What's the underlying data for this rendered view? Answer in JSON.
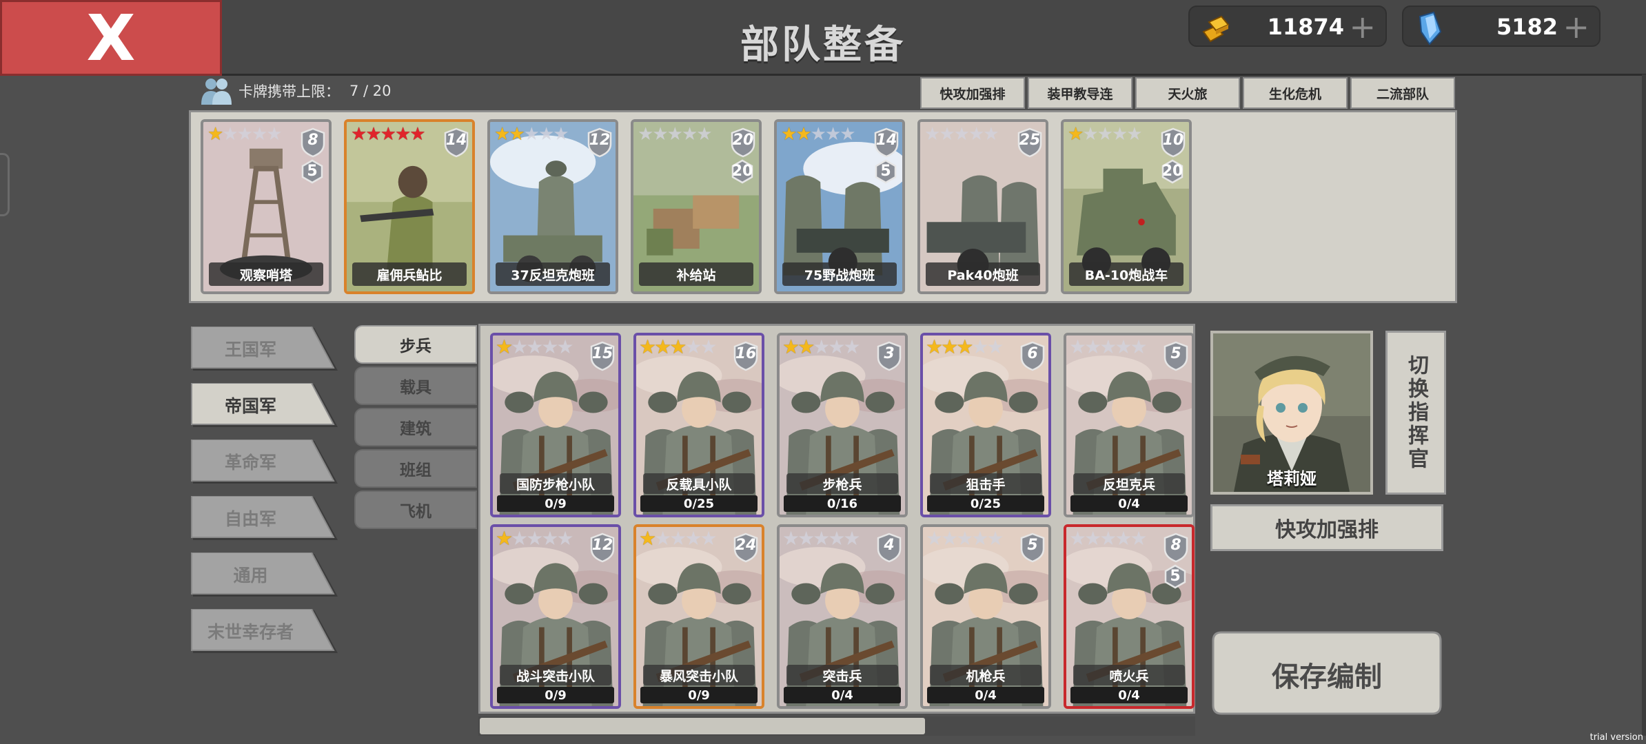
{
  "header": {
    "close_label": "X",
    "title": "部队整备",
    "gold": {
      "value": "11874",
      "icon": "gold-bars-icon",
      "plus": "+"
    },
    "crystal": {
      "value": "5182",
      "icon": "blue-crystal-icon",
      "plus": "+"
    }
  },
  "deck": {
    "carry_limit_label": "卡牌携带上限：",
    "carry_limit_value": "7 / 20",
    "preset_tabs": [
      "快攻加强排",
      "装甲教导连",
      "天火旅",
      "生化危机",
      "二流部队"
    ],
    "cards": [
      {
        "name": "观察哨塔",
        "stars": 1,
        "star_color": "gold",
        "cost": "8",
        "sub": "5",
        "frame": "gray"
      },
      {
        "name": "雇佣兵鲇比",
        "stars": 5,
        "star_color": "red",
        "cost": "14",
        "sub": null,
        "frame": "orange"
      },
      {
        "name": "37反坦克炮班",
        "stars": 2,
        "star_color": "gold",
        "cost": "12",
        "sub": null,
        "frame": "gray"
      },
      {
        "name": "补给站",
        "stars": 0,
        "star_color": "gold",
        "cost": "20",
        "sub": "20",
        "frame": "gray"
      },
      {
        "name": "75野战炮班",
        "stars": 2,
        "star_color": "gold",
        "cost": "14",
        "sub": "5",
        "frame": "gray"
      },
      {
        "name": "Pak40炮班",
        "stars": 0,
        "star_color": "gold",
        "cost": "25",
        "sub": null,
        "frame": "gray"
      },
      {
        "name": "BA-10炮战车",
        "stars": 1,
        "star_color": "gold",
        "cost": "10",
        "sub": "20",
        "frame": "gray"
      }
    ]
  },
  "factions": [
    "王国军",
    "帝国军",
    "革命军",
    "自由军",
    "通用",
    "末世幸存者"
  ],
  "active_faction": 1,
  "categories": [
    "步兵",
    "载具",
    "建筑",
    "班组",
    "飞机"
  ],
  "active_category": 0,
  "units": [
    {
      "name": "国防步枪小队",
      "count": "0/9",
      "stars": 1,
      "cost": "15",
      "sub": null,
      "frame": "purple"
    },
    {
      "name": "反载具小队",
      "count": "0/25",
      "stars": 3,
      "cost": "16",
      "sub": null,
      "frame": "purple"
    },
    {
      "name": "步枪兵",
      "count": "0/16",
      "stars": 2,
      "cost": "3",
      "sub": null,
      "frame": "gray"
    },
    {
      "name": "狙击手",
      "count": "0/25",
      "stars": 3,
      "cost": "6",
      "sub": null,
      "frame": "purple"
    },
    {
      "name": "反坦克兵",
      "count": "0/4",
      "stars": 0,
      "cost": "5",
      "sub": null,
      "frame": "gray"
    },
    {
      "name": "战斗突击小队",
      "count": "0/9",
      "stars": 1,
      "cost": "12",
      "sub": null,
      "frame": "purple"
    },
    {
      "name": "暴风突击小队",
      "count": "0/9",
      "stars": 1,
      "cost": "24",
      "sub": null,
      "frame": "orange"
    },
    {
      "name": "突击兵",
      "count": "0/4",
      "stars": 0,
      "cost": "4",
      "sub": null,
      "frame": "gray"
    },
    {
      "name": "机枪兵",
      "count": "0/4",
      "stars": 0,
      "cost": "5",
      "sub": null,
      "frame": "gray"
    },
    {
      "name": "喷火兵",
      "count": "0/4",
      "stars": 0,
      "cost": "8",
      "sub": "5",
      "frame": "red"
    }
  ],
  "commander": {
    "name": "塔莉娅",
    "switch_label": "切换指挥官",
    "preset_name": "快攻加强排"
  },
  "save_label": "保存编制",
  "watermark": "trial version",
  "colors": {
    "close_red": "#cc4c4c",
    "panel_beige": "#d3d1c9",
    "star_gold": "#f4b81c",
    "star_red": "#e0242b",
    "frame_purple": "#6a4fa8",
    "frame_orange": "#d9822b",
    "frame_red": "#c8282c"
  }
}
